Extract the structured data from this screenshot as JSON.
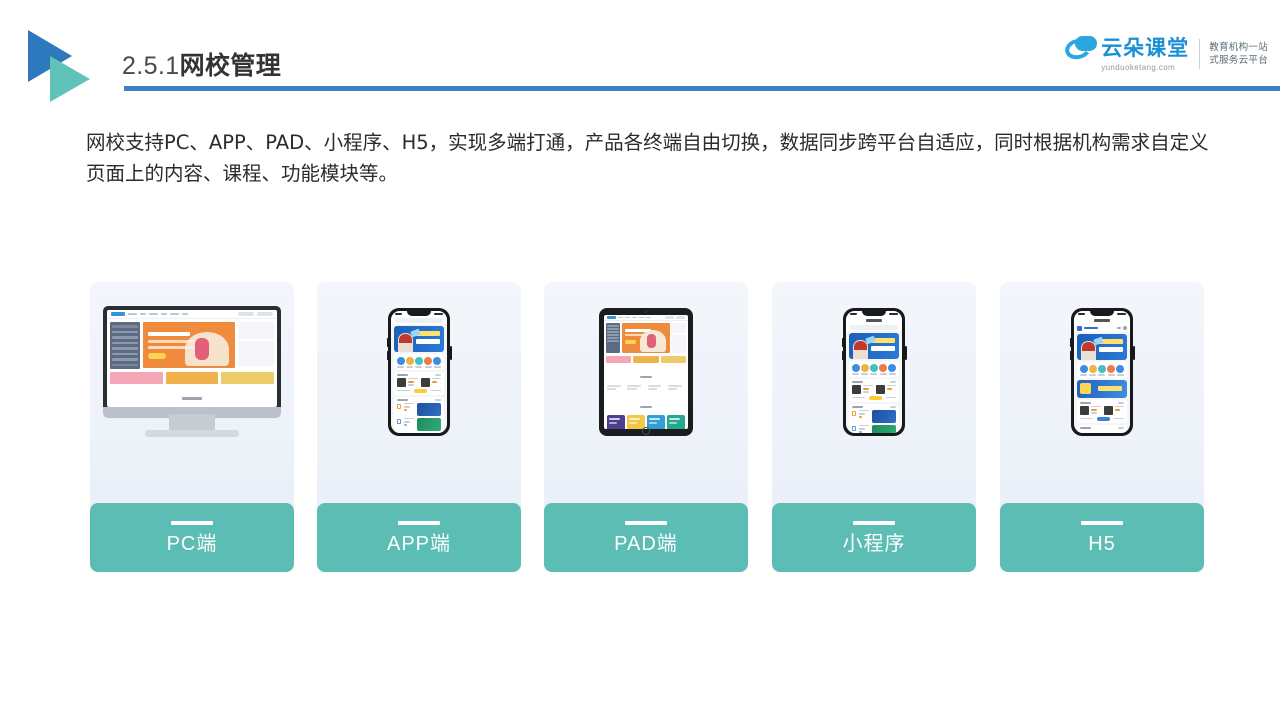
{
  "header": {
    "section_number": "2.5.1",
    "section_title": "网校管理",
    "logo_icon": "double-triangle-logo",
    "rule_color": "#3B81C4"
  },
  "brand": {
    "icon": "cloud-icon",
    "name_cn": "云朵课堂",
    "url": "yunduoketang.com",
    "tagline_line1": "教育机构一站",
    "tagline_line2": "式服务云平台",
    "color": "#1b8fd6"
  },
  "body_copy": {
    "paragraph": "网校支持PC、APP、PAD、小程序、H5，实现多端打通，产品各终端自由切换，数据同步跨平台自适应，同时根据机构需求自定义页面上的内容、课程、功能模块等。"
  },
  "platform_cards": [
    {
      "id": "pc",
      "label": "PC端",
      "device": "desktop-monitor",
      "icon": "monitor-icon"
    },
    {
      "id": "app",
      "label": "APP端",
      "device": "smartphone",
      "icon": "phone-icon"
    },
    {
      "id": "pad",
      "label": "PAD端",
      "device": "tablet",
      "icon": "tablet-icon"
    },
    {
      "id": "mini",
      "label": "小程序",
      "device": "smartphone",
      "icon": "phone-icon"
    },
    {
      "id": "h5",
      "label": "H5",
      "device": "smartphone",
      "icon": "phone-icon"
    }
  ],
  "theme": {
    "label_bg": "#5CBDB5",
    "card_bg_top": "#f3f6fb",
    "card_bg_bottom": "#e9eef7",
    "accent_blue": "#2E79BD",
    "accent_teal": "#5FC3BA",
    "text_dark": "#2b2b2b"
  }
}
